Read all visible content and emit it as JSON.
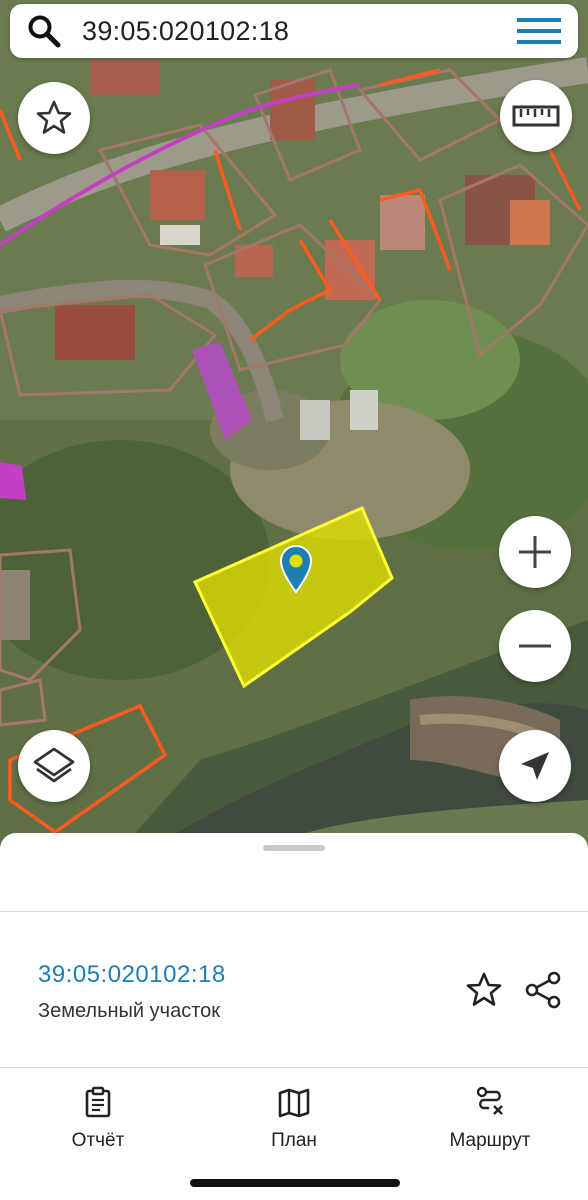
{
  "search": {
    "query": "39:05:020102:18"
  },
  "map": {
    "colors": {
      "selected_fill": "#e0e000",
      "selected_border": "#ffff33",
      "boundary_orange": "#ff5a1f",
      "boundary_brown": "#a5766a",
      "zone_purple": "#c43fc3"
    },
    "controls": [
      "favorite",
      "ruler",
      "zoom-in",
      "zoom-out",
      "layers",
      "my-location"
    ]
  },
  "sheet": {
    "cadastral_number": "39:05:020102:18",
    "object_type": "Земельный участок"
  },
  "bottom_nav": {
    "items": [
      {
        "id": "report",
        "label": "Отчёт",
        "icon": "clipboard-icon"
      },
      {
        "id": "plan",
        "label": "План",
        "icon": "map-icon"
      },
      {
        "id": "route",
        "label": "Маршрут",
        "icon": "route-icon"
      }
    ]
  }
}
